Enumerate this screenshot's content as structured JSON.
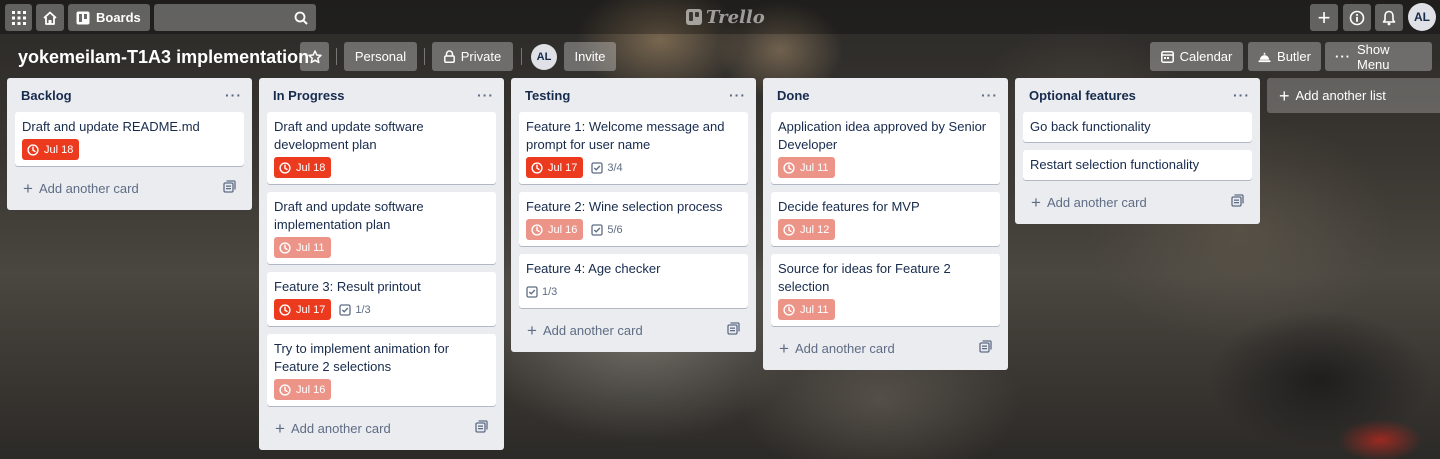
{
  "header": {
    "boards_label": "Boards",
    "search_placeholder": "",
    "logo_text": "Trello",
    "user_initials": "AL"
  },
  "board": {
    "title": "yokemeilam-T1A3 implementation",
    "personal_label": "Personal",
    "private_label": "Private",
    "member_initials": "AL",
    "invite_label": "Invite",
    "calendar_label": "Calendar",
    "butler_label": "Butler",
    "show_menu_label": "Show Menu"
  },
  "colors": {
    "due_overdue": "#eb3a1e",
    "due_past": "#ec9488"
  },
  "lists": [
    {
      "title": "Backlog",
      "add_card_label": "Add another card",
      "cards": [
        {
          "title": "Draft and update README.md",
          "due": "Jul 18",
          "due_style": "overdue",
          "checklist": null
        }
      ]
    },
    {
      "title": "In Progress",
      "add_card_label": "Add another card",
      "cards": [
        {
          "title": "Draft and update software development plan",
          "due": "Jul 18",
          "due_style": "overdue",
          "checklist": null
        },
        {
          "title": "Draft and update software implementation plan",
          "due": "Jul 11",
          "due_style": "past",
          "checklist": null
        },
        {
          "title": "Feature 3: Result printout",
          "due": "Jul 17",
          "due_style": "overdue",
          "checklist": "1/3"
        },
        {
          "title": "Try to implement animation for Feature 2 selections",
          "due": "Jul 16",
          "due_style": "past",
          "checklist": null
        }
      ]
    },
    {
      "title": "Testing",
      "add_card_label": "Add another card",
      "cards": [
        {
          "title": "Feature 1: Welcome message and prompt for user name",
          "due": "Jul 17",
          "due_style": "overdue",
          "checklist": "3/4"
        },
        {
          "title": "Feature 2: Wine selection process",
          "due": "Jul 16",
          "due_style": "past",
          "checklist": "5/6"
        },
        {
          "title": "Feature 4: Age checker",
          "due": null,
          "due_style": null,
          "checklist": "1/3"
        }
      ]
    },
    {
      "title": "Done",
      "add_card_label": "Add another card",
      "cards": [
        {
          "title": "Application idea approved by Senior Developer",
          "due": "Jul 11",
          "due_style": "past",
          "checklist": null
        },
        {
          "title": "Decide features for MVP",
          "due": "Jul 12",
          "due_style": "past",
          "checklist": null
        },
        {
          "title": "Source for ideas for Feature 2 selection",
          "due": "Jul 11",
          "due_style": "past",
          "checklist": null
        }
      ]
    },
    {
      "title": "Optional features",
      "add_card_label": "Add another card",
      "cards": [
        {
          "title": "Go back functionality",
          "due": null,
          "due_style": null,
          "checklist": null
        },
        {
          "title": "Restart selection functionality",
          "due": null,
          "due_style": null,
          "checklist": null
        }
      ]
    }
  ],
  "add_list_label": "Add another list"
}
